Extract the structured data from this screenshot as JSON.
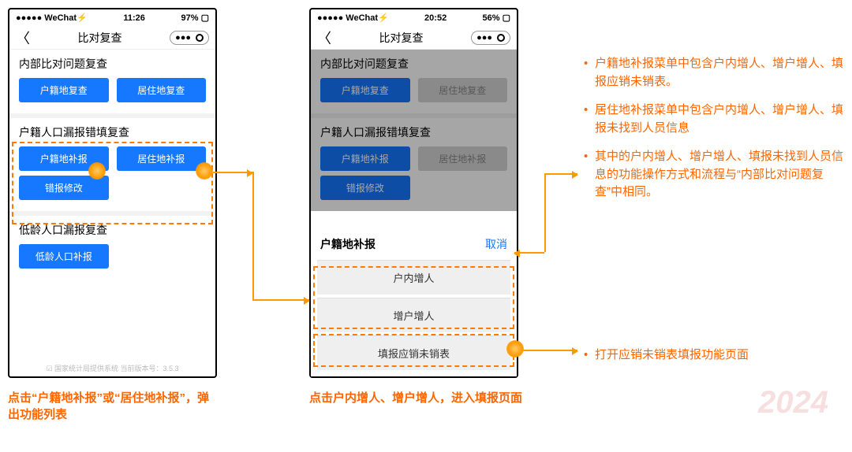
{
  "phone1": {
    "statusbar": {
      "carrier": "●●●●● WeChat⚡",
      "time": "11:26",
      "battery": "97% ▢"
    },
    "titlebar": {
      "title": "比对复查",
      "dots": "●●●"
    },
    "section1": {
      "title": "内部比对问题复查",
      "btn1": "户籍地复查",
      "btn2": "居住地复查"
    },
    "section2": {
      "title": "户籍人口漏报错填复查",
      "btn1": "户籍地补报",
      "btn2": "居住地补报",
      "btn3": "错报修改"
    },
    "section3": {
      "title": "低龄人口漏报复查",
      "btn1": "低龄人口补报"
    },
    "footer": "☑ 国家统计局提供系统 当前版本号：3.5.3"
  },
  "phone2": {
    "statusbar": {
      "carrier": "●●●●● WeChat⚡",
      "time": "20:52",
      "battery": "56% ▢"
    },
    "titlebar": {
      "title": "比对复查",
      "dots": "●●●"
    },
    "section1": {
      "title": "内部比对问题复查",
      "btn1": "户籍地复查",
      "btn2": "居住地复查"
    },
    "section2": {
      "title": "户籍人口漏报错填复查",
      "btn1": "户籍地补报",
      "btn2": "居住地补报",
      "btn3": "错报修改"
    },
    "sheet": {
      "title": "户籍地补报",
      "cancel": "取消",
      "item1": "户内增人",
      "item2": "增户增人",
      "item3": "填报应销未销表"
    }
  },
  "captions": {
    "c1": "点击“户籍地补报”或“居住地补报”，弹出功能列表",
    "c2": "点击户内增人、增户增人，进入填报页面"
  },
  "bullets": {
    "b1": "户籍地补报菜单中包含户内增人、增户增人、填报应销未销表。",
    "b2": "居住地补报菜单中包含户内增人、增户增人、填报未找到人员信息",
    "b3": "其中的户内增人、增户增人、填报未找到人员信息的功能操作方式和流程与“内部比对问题复查”中相同。",
    "b4": "打开应销未销表填报功能页面"
  },
  "watermark": "2024"
}
